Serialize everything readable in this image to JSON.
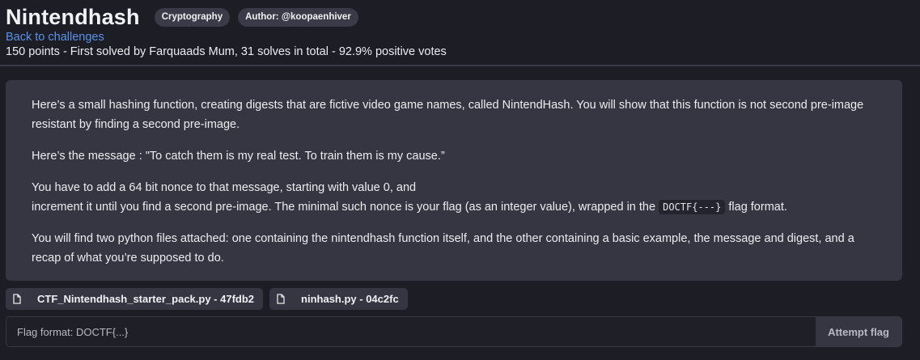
{
  "challenge": {
    "title": "Nintendhash",
    "tags": [
      "Cryptography",
      "Author: @koopaenhiver"
    ],
    "back_link": "Back to challenges",
    "meta": "150 points - First solved by Farquaads Mum, 31 solves in total - 92.9% positive votes"
  },
  "description": {
    "p1": "Here’s a small hashing function, creating digests that are fictive video game names, called NintendHash. You will show that this function is not second pre-image resistant by finding a second pre-image.",
    "p2": "Here’s the message : \"To catch them is my real test. To train them is my cause.”",
    "p3_line1": "You have to add a 64 bit nonce to that message, starting with value 0, and",
    "p3_line2_before": "increment it until you find a second pre-image. The minimal such nonce is your flag (as an integer value), wrapped in the",
    "p3_code": "DOCTF{---}",
    "p3_line2_after": "flag format.",
    "p4": "You will find two python files attached: one containing the nintendhash function itself, and the other containing a basic example, the message and digest, and a recap of what you’re supposed to do."
  },
  "files": [
    {
      "label": "CTF_Nintendhash_starter_pack.py - 47fdb2",
      "icon": "file-icon"
    },
    {
      "label": "ninhash.py - 04c2fc",
      "icon": "file-icon"
    }
  ],
  "flag": {
    "placeholder": "Flag format: DOCTF{...}",
    "value": "",
    "submit_label": "Attempt flag"
  }
}
